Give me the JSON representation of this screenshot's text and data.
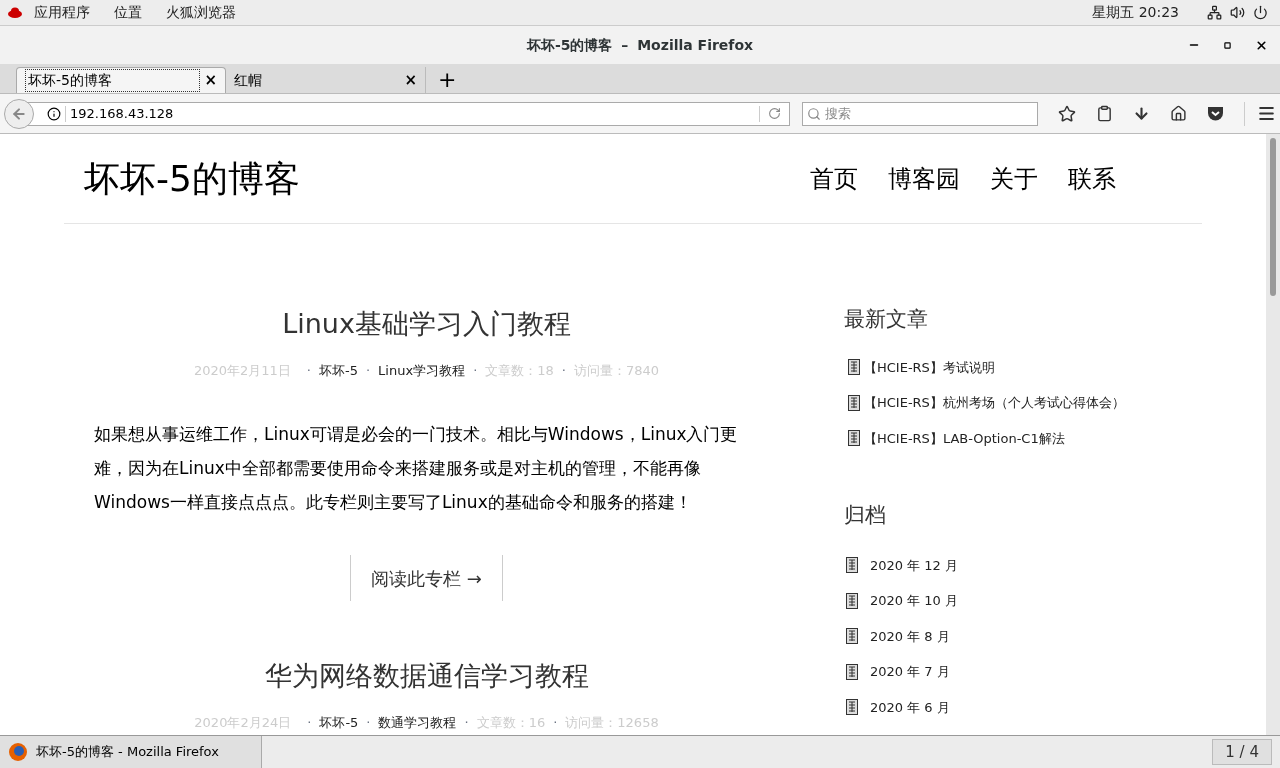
{
  "top_bar": {
    "menus": [
      "应用程序",
      "位置",
      "火狐浏览器"
    ],
    "clock": "星期五 20:23"
  },
  "window": {
    "title": "坏坏-5的博客",
    "app": "Mozilla Firefox",
    "separator": "–"
  },
  "tabs": [
    {
      "label": "坏坏-5的博客",
      "selected": true
    },
    {
      "label": "红帽",
      "selected": false
    }
  ],
  "tab_close": "×",
  "new_tab": "+",
  "address_bar": {
    "value": "192.168.43.128"
  },
  "search": {
    "placeholder": "搜索"
  },
  "site": {
    "title": "坏坏-5的博客",
    "nav": [
      "首页",
      "博客园",
      "关于",
      "联系"
    ]
  },
  "posts": [
    {
      "title": "Linux基础学习入门教程",
      "date": "2020年2月11日",
      "author": "坏坏-5",
      "category": "Linux学习教程",
      "count": "文章数：18",
      "views": "访问量：7840",
      "excerpt": "如果想从事运维工作，Linux可谓是必会的一门技术。相比与Windows，Linux入门更难，因为在Linux中全部都需要使用命令来搭建服务或是对主机的管理，不能再像Windows一样直接点点点。此专栏则主要写了Linux的基础命令和服务的搭建！",
      "read_more": "阅读此专栏 →"
    },
    {
      "title": "华为网络数据通信学习教程",
      "date": "2020年2月24日",
      "author": "坏坏-5",
      "category": "数通学习教程",
      "count": "文章数：16",
      "views": "访问量：12658"
    }
  ],
  "meta_separator": "·",
  "sidebar": {
    "recent_title": "最新文章",
    "recent": [
      "【HCIE-RS】考试说明",
      "【HCIE-RS】杭州考场（个人考试心得体会）",
      "【HCIE-RS】LAB-Option-C1解法"
    ],
    "archive_title": "归档",
    "archive": [
      "2020 年 12 月",
      "2020 年 10 月",
      "2020 年 8 月",
      "2020 年 7 月",
      "2020 年 6 月"
    ]
  },
  "taskbar": {
    "window": "坏坏-5的博客 - Mozilla Firefox",
    "workspace": "1 / 4"
  }
}
